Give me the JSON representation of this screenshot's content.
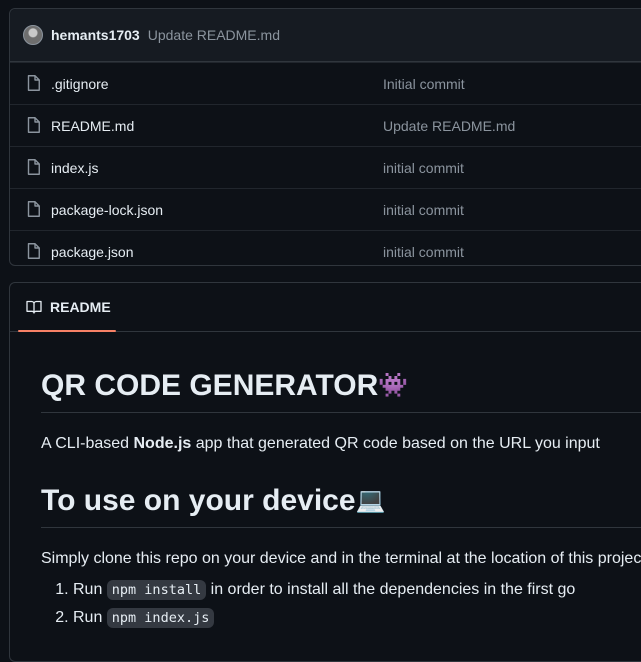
{
  "latest_commit": {
    "author": "hemants1703",
    "message": "Update README.md"
  },
  "files": [
    {
      "name": ".gitignore",
      "commit": "Initial commit"
    },
    {
      "name": "README.md",
      "commit": "Update README.md"
    },
    {
      "name": "index.js",
      "commit": "initial commit"
    },
    {
      "name": "package-lock.json",
      "commit": "initial commit"
    },
    {
      "name": "package.json",
      "commit": "initial commit"
    }
  ],
  "readme": {
    "tab_label": "README",
    "title": "QR CODE GENERATOR",
    "title_emoji": "👾",
    "intro_prefix": "A CLI-based ",
    "intro_bold": "Node.js",
    "intro_suffix": " app that generated QR code based on the URL you input",
    "heading2": "To use on your device",
    "heading2_emoji": "💻",
    "usage_text": "Simply clone this repo on your device and in the terminal at the location of this project",
    "steps": [
      {
        "prefix": "Run ",
        "code": "npm install",
        "suffix": " in order to install all the dependencies in the first go"
      },
      {
        "prefix": "Run ",
        "code": "npm index.js",
        "suffix": ""
      }
    ]
  },
  "colors": {
    "background": "#0d1117",
    "border": "#30363d",
    "muted_text": "#8b949e",
    "tab_underline": "#f78166"
  }
}
